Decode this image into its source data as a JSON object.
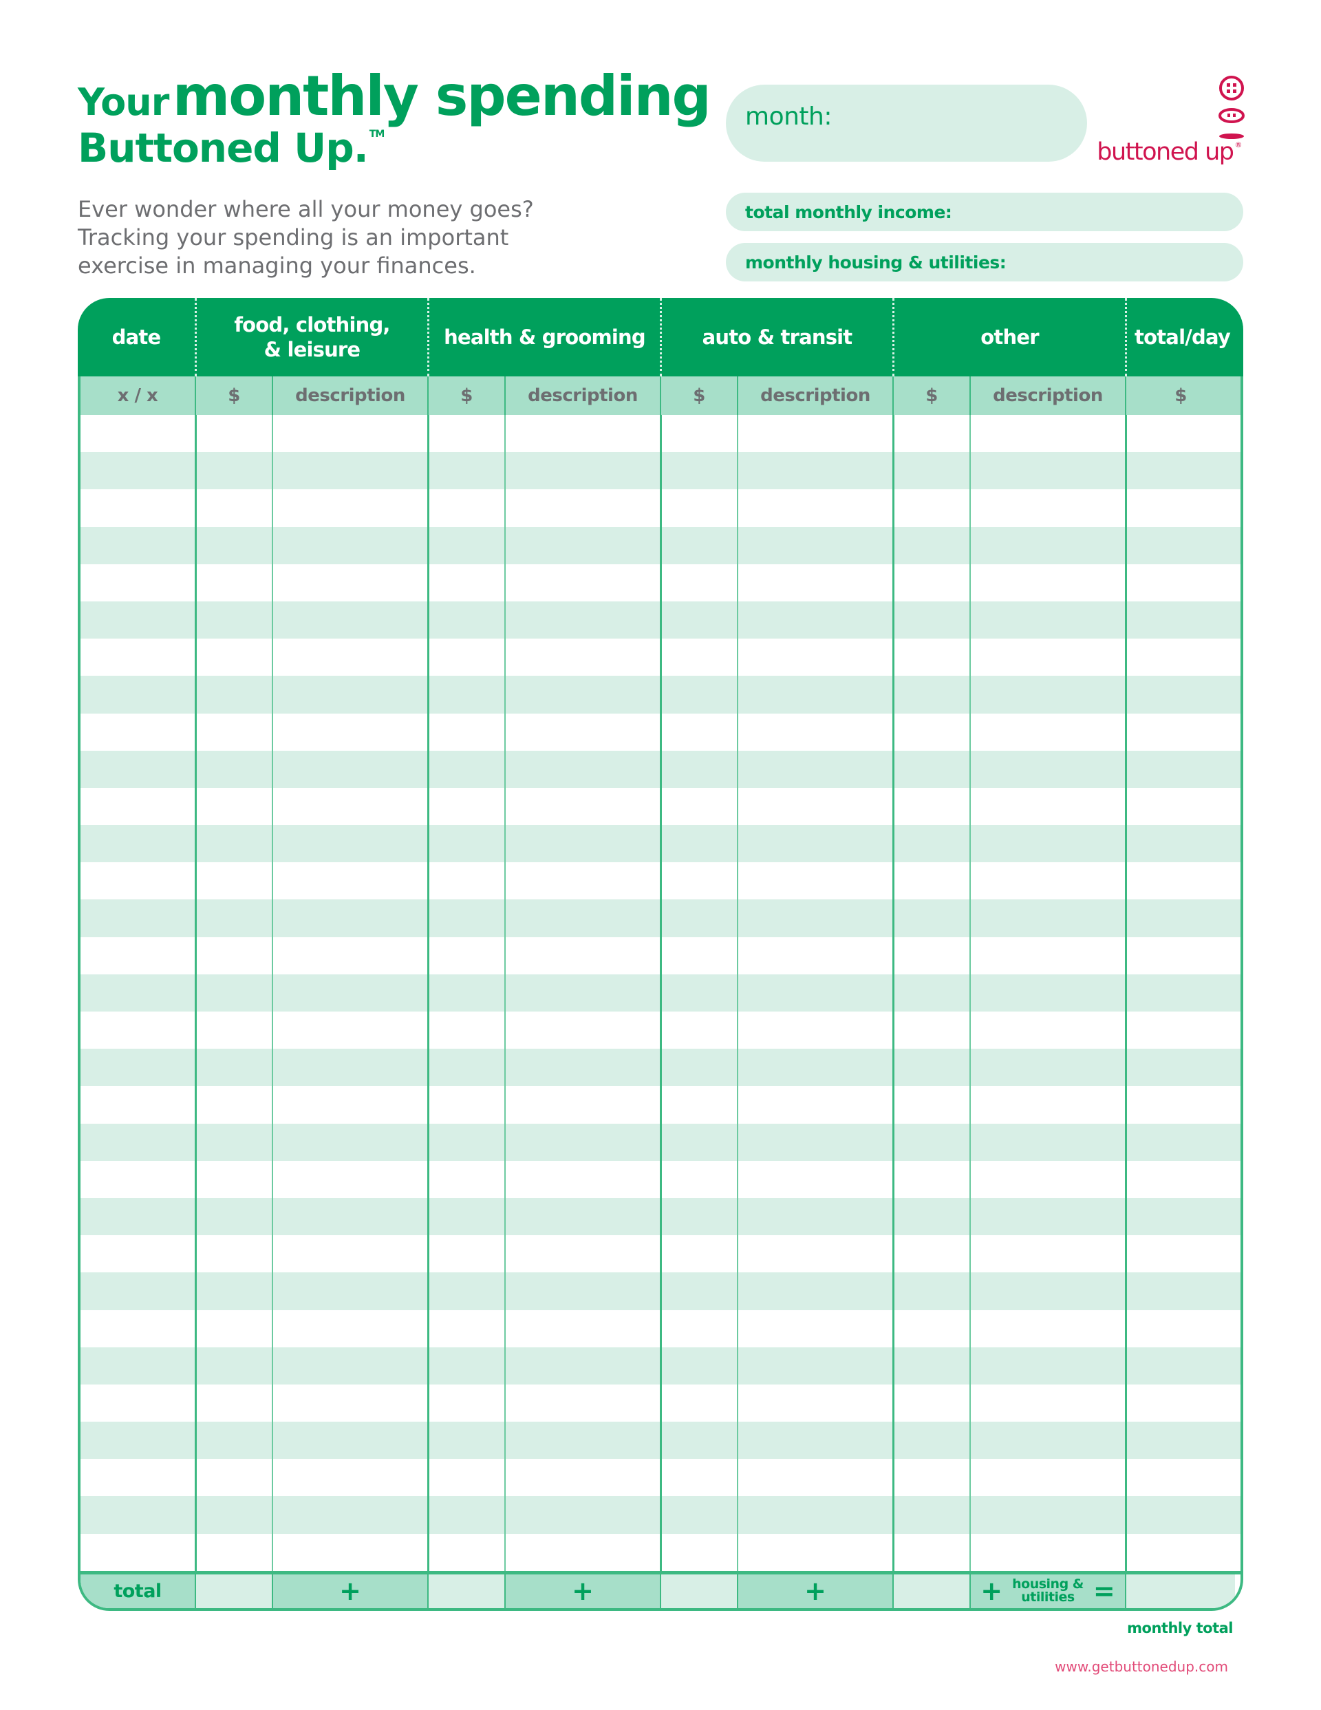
{
  "title": {
    "word_your": "Your",
    "words_monthly_spending": "monthly spending",
    "line2": "Buttoned Up.",
    "trademark": "TM"
  },
  "intro": {
    "lines": [
      "Ever wonder where all your money goes?",
      "Tracking your spending is an important",
      "exercise in managing your finances."
    ]
  },
  "fields": {
    "month_label": "month:",
    "month_value": "",
    "income_label": "total monthly income:",
    "income_value": "",
    "housing_label": "monthly housing & utilities:",
    "housing_value": ""
  },
  "logo": {
    "text": "buttoned up",
    "registered": "®",
    "icon": "buttons-stack-icon",
    "color": "#d0144f"
  },
  "table": {
    "headers": [
      {
        "label": "date",
        "span": 1
      },
      {
        "label": "food, clothing,\n& leisure",
        "span": 2
      },
      {
        "label": "health & grooming",
        "span": 2
      },
      {
        "label": "auto & transit",
        "span": 2
      },
      {
        "label": "other",
        "span": 2
      },
      {
        "label": "total/day",
        "span": 1
      }
    ],
    "subheaders": [
      "x / x",
      "$",
      "description",
      "$",
      "description",
      "$",
      "description",
      "$",
      "description",
      "$"
    ],
    "row_count": 31,
    "totals": {
      "label": "total",
      "plus": "+",
      "housing_small": "housing &\nutilities",
      "equals": "="
    }
  },
  "footer": {
    "monthly_total": "monthly total",
    "website": "www.getbuttonedup.com"
  },
  "colors": {
    "brand_green": "#00a05c",
    "light_green": "#d8efe6",
    "mid_green": "#a7dfc9",
    "line_green": "#3db982",
    "brand_red": "#d0144f",
    "gray_text": "#6d6e71"
  }
}
